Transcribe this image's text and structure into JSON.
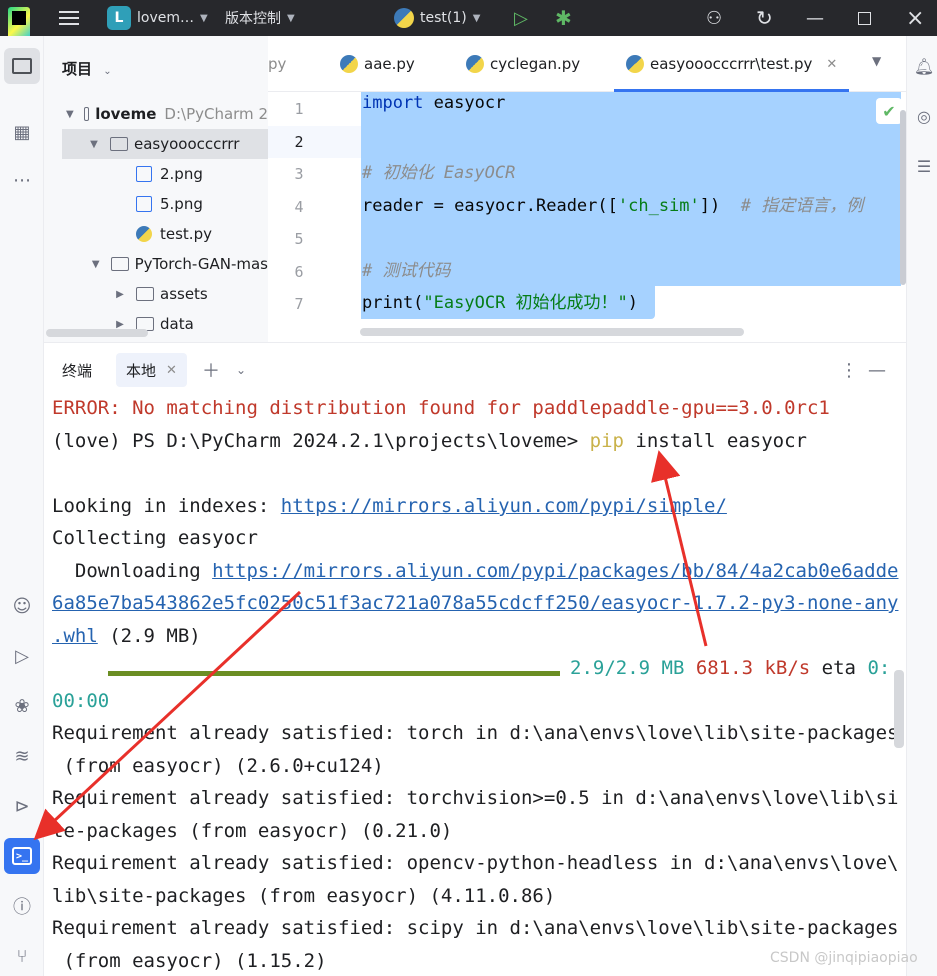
{
  "titlebar": {
    "project_badge": "L",
    "project_name": "lovem…",
    "vcs": "版本控制",
    "run_config": "test(1)"
  },
  "project_panel": {
    "title": "项目",
    "tree": [
      {
        "label": "loveme",
        "path": "D:\\PyCharm 2",
        "kind": "folder",
        "expanded": true
      },
      {
        "label": "easyooocccrrr",
        "kind": "folder",
        "expanded": true,
        "selected": true
      },
      {
        "label": "2.png",
        "kind": "png"
      },
      {
        "label": "5.png",
        "kind": "png"
      },
      {
        "label": "test.py",
        "kind": "py"
      },
      {
        "label": "PyTorch-GAN-mas",
        "kind": "folder",
        "expanded": true
      },
      {
        "label": "assets",
        "kind": "folder",
        "expanded": false
      },
      {
        "label": "data",
        "kind": "folder",
        "expanded": false
      }
    ]
  },
  "editor": {
    "tabs": [
      {
        "label": "py",
        "active": false
      },
      {
        "label": "aae.py",
        "active": false
      },
      {
        "label": "cyclegan.py",
        "active": false
      },
      {
        "label": "easyooocccrrr\\test.py",
        "active": true
      }
    ],
    "line_numbers": [
      "1",
      "2",
      "3",
      "4",
      "5",
      "6",
      "7"
    ],
    "code": {
      "l1_kw": "import",
      "l1_rest": " easyocr",
      "l3": "# 初始化 EasyOCR",
      "l4_code": "reader = easyocr.Reader([",
      "l4_str": "'ch_sim'",
      "l4_close": "])  ",
      "l4_cmt": "# 指定语言，例",
      "l6": "# 测试代码",
      "l7_open": "print(",
      "l7_str": "\"EasyOCR 初始化成功！\"",
      "l7_close": ")"
    }
  },
  "terminal": {
    "tab_label": "终端",
    "local_tab": "本地",
    "lines": {
      "error": "ERROR: No matching distribution found for paddlepaddle-gpu==3.0.0rc1",
      "prompt": "(love) PS D:\\PyCharm 2024.2.1\\projects\\loveme> ",
      "cmd_pip": "pip",
      "cmd_rest": " install easyocr",
      "looking": "Looking in indexes: ",
      "looking_url": "https://mirrors.aliyun.com/pypi/simple/",
      "collecting": "Collecting easyocr",
      "downloading": "  Downloading ",
      "dl_url_1": "https://mirrors.aliyun.com/pypi/packages/bb/84/4a2cab0e6adde",
      "dl_url_2": "6a85e7ba543862e5fc0250c51f3ac721a078a55cdcff250/easyocr-1.7.2-py3-none-any",
      "dl_url_3": ".whl",
      "dl_size": " (2.9 MB)",
      "progress_size": "2.9/2.9 MB",
      "progress_rate": "681.3 kB/s",
      "eta_label": " eta ",
      "eta_1": "0:",
      "eta_2": "00:00",
      "req1a": "Requirement already satisfied: torch in d:\\ana\\envs\\love\\lib\\site-packages",
      "req1b": " (from easyocr) (2.6.0+cu124)",
      "req2a": "Requirement already satisfied: torchvision>=0.5 in d:\\ana\\envs\\love\\lib\\si",
      "req2b": "te-packages (from easyocr) (0.21.0)",
      "req3a": "Requirement already satisfied: opencv-python-headless in d:\\ana\\envs\\love\\",
      "req3b": "lib\\site-packages (from easyocr) (4.11.0.86)",
      "req4a": "Requirement already satisfied: scipy in d:\\ana\\envs\\love\\lib\\site-packages",
      "req4b": " (from easyocr) (1.15.2)"
    },
    "progress_fraction": 1.0
  },
  "watermark": "CSDN @jinqipiaopiao",
  "colors": {
    "accent": "#3574f0",
    "selection": "#a6d2ff",
    "annotation": "#e8302a"
  }
}
